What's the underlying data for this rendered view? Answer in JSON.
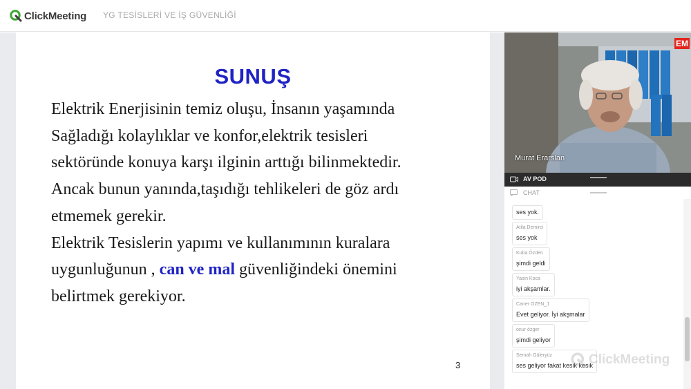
{
  "header": {
    "brand": "ClickMeeting",
    "event_title": "YG TESİSLERİ VE İŞ GÜVENLİĞİ"
  },
  "slide": {
    "title": "SUNUŞ",
    "lines": [
      "Elektrik Enerjisinin temiz oluşu, İnsanın yaşamında",
      "Sağladığı kolaylıklar ve konfor,elektrik tesisleri",
      "sektöründe konuya karşı ilginin arttığı bilinmektedir.",
      "Ancak bunun yanında,taşıdığı tehlikeleri de göz ardı",
      "etmemek gerekir.",
      "Elektrik Tesislerin yapımı ve kullanımının kuralara"
    ],
    "line7_before": "uygunluğunun , ",
    "line7_highlight": "can ve mal",
    "line7_after": " güvenliğindeki önemini",
    "line8": "belirtmek gerekiyor.",
    "page_number": "3"
  },
  "video": {
    "presenter_name": "Murat Erarslan",
    "badge": "EM"
  },
  "pods": {
    "av_label": "AV POD",
    "chat_label": "CHAT"
  },
  "chat": {
    "messages": [
      {
        "author": "",
        "text": "ses yok."
      },
      {
        "author": "Atila Demirci",
        "text": "ses yok"
      },
      {
        "author": "Kuba Özden",
        "text": "şimdi geldi"
      },
      {
        "author": "Yasin Koca",
        "text": "iyi akşamlar."
      },
      {
        "author": "Caner ÖZEN_1",
        "text": "Evet geliyor. İyi akşmalar"
      },
      {
        "author": "onur özger",
        "text": "şimdi geliyor"
      },
      {
        "author": "Semah Güleryüz",
        "text": "ses geliyor fakat kesik kesik"
      }
    ]
  },
  "watermark": "ClickMeeting",
  "colors": {
    "accent_blue": "#1f23c4",
    "brand_green": "#3fa535",
    "badge_red": "#e2261f"
  }
}
